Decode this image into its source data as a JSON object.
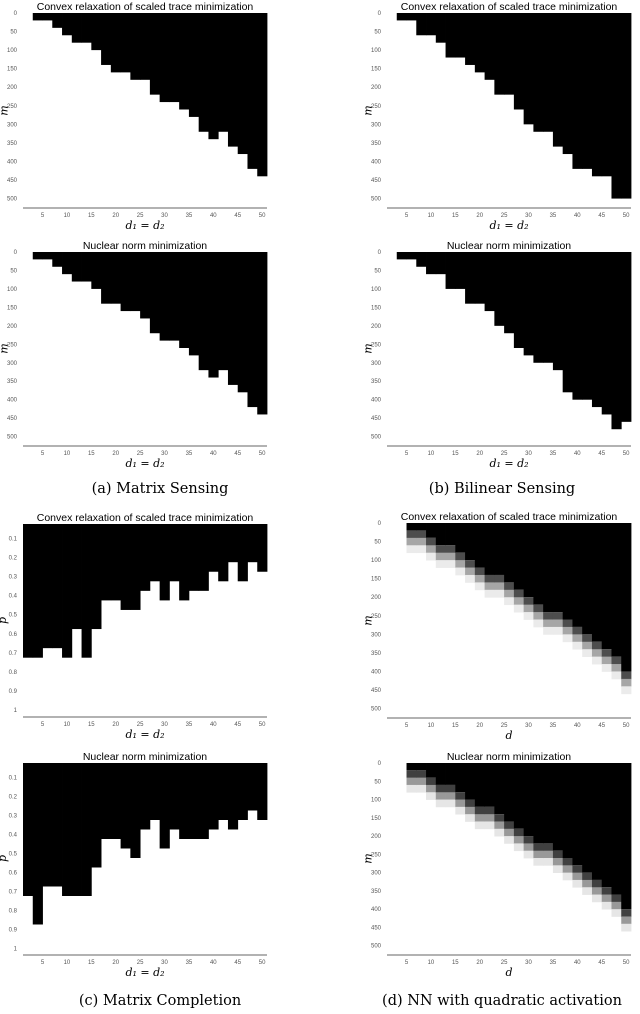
{
  "captions": {
    "a": "(a) Matrix Sensing",
    "b": "(b) Bilinear Sensing",
    "c": "(c) Matrix Completion",
    "d": "(d) NN with quadratic activation"
  },
  "colors": {
    "failure": "#000000",
    "success": "#ffffff",
    "axis": "#999999"
  },
  "chart_data": [
    {
      "id": "a1",
      "type": "heatmap",
      "title": "Convex relaxation of scaled trace minimization",
      "xlabel": "d₁ = d₂",
      "ylabel": "m",
      "x_columns": [
        2,
        4,
        6,
        8,
        10,
        12,
        14,
        16,
        18,
        20,
        22,
        24,
        26,
        28,
        30,
        32,
        34,
        36,
        38,
        40,
        42,
        44,
        46,
        48,
        50
      ],
      "xticks": [
        5,
        10,
        15,
        20,
        25,
        30,
        35,
        40,
        45,
        50
      ],
      "yticks": [
        0,
        50,
        100,
        150,
        200,
        250,
        300,
        350,
        400,
        450,
        500
      ],
      "ylim": [
        0,
        520
      ],
      "failure_boundary": [
        0,
        20,
        20,
        40,
        60,
        80,
        80,
        100,
        140,
        160,
        160,
        180,
        180,
        220,
        240,
        240,
        260,
        280,
        320,
        340,
        320,
        360,
        380,
        420,
        440
      ]
    },
    {
      "id": "a2",
      "type": "heatmap",
      "title": "Nuclear norm minimization",
      "xlabel": "d₁ = d₂",
      "ylabel": "m",
      "x_columns": [
        2,
        4,
        6,
        8,
        10,
        12,
        14,
        16,
        18,
        20,
        22,
        24,
        26,
        28,
        30,
        32,
        34,
        36,
        38,
        40,
        42,
        44,
        46,
        48,
        50
      ],
      "xticks": [
        5,
        10,
        15,
        20,
        25,
        30,
        35,
        40,
        45,
        50
      ],
      "yticks": [
        0,
        50,
        100,
        150,
        200,
        250,
        300,
        350,
        400,
        450,
        500
      ],
      "ylim": [
        0,
        520
      ],
      "failure_boundary": [
        0,
        20,
        20,
        40,
        60,
        80,
        80,
        100,
        140,
        140,
        160,
        160,
        180,
        220,
        240,
        240,
        260,
        280,
        320,
        340,
        320,
        360,
        380,
        420,
        440
      ]
    },
    {
      "id": "b1",
      "type": "heatmap",
      "title": "Convex relaxation of scaled trace minimization",
      "xlabel": "d₁ = d₂",
      "ylabel": "m",
      "x_columns": [
        2,
        4,
        6,
        8,
        10,
        12,
        14,
        16,
        18,
        20,
        22,
        24,
        26,
        28,
        30,
        32,
        34,
        36,
        38,
        40,
        42,
        44,
        46,
        48,
        50
      ],
      "xticks": [
        5,
        10,
        15,
        20,
        25,
        30,
        35,
        40,
        45,
        50
      ],
      "yticks": [
        0,
        50,
        100,
        150,
        200,
        250,
        300,
        350,
        400,
        450,
        500
      ],
      "ylim": [
        0,
        520
      ],
      "failure_boundary": [
        0,
        20,
        20,
        60,
        60,
        80,
        120,
        120,
        140,
        160,
        180,
        220,
        220,
        260,
        300,
        320,
        320,
        360,
        380,
        420,
        420,
        440,
        440,
        500,
        500
      ]
    },
    {
      "id": "b2",
      "type": "heatmap",
      "title": "Nuclear norm minimization",
      "xlabel": "d₁ = d₂",
      "ylabel": "m",
      "x_columns": [
        2,
        4,
        6,
        8,
        10,
        12,
        14,
        16,
        18,
        20,
        22,
        24,
        26,
        28,
        30,
        32,
        34,
        36,
        38,
        40,
        42,
        44,
        46,
        48,
        50
      ],
      "xticks": [
        5,
        10,
        15,
        20,
        25,
        30,
        35,
        40,
        45,
        50
      ],
      "yticks": [
        0,
        50,
        100,
        150,
        200,
        250,
        300,
        350,
        400,
        450,
        500
      ],
      "ylim": [
        0,
        520
      ],
      "failure_boundary": [
        0,
        20,
        20,
        40,
        60,
        60,
        100,
        100,
        140,
        140,
        160,
        200,
        220,
        260,
        280,
        300,
        300,
        320,
        380,
        400,
        400,
        420,
        440,
        480,
        460
      ]
    },
    {
      "id": "c1",
      "type": "heatmap",
      "title": "Convex relaxation of scaled trace minimization",
      "xlabel": "d₁ = d₂",
      "ylabel": "p",
      "x_columns": [
        2,
        4,
        6,
        8,
        10,
        12,
        14,
        16,
        18,
        20,
        22,
        24,
        26,
        28,
        30,
        32,
        34,
        36,
        38,
        40,
        42,
        44,
        46,
        48,
        50
      ],
      "xticks": [
        5,
        10,
        15,
        20,
        25,
        30,
        35,
        40,
        45,
        50
      ],
      "yticks": [
        0.1,
        0.2,
        0.3,
        0.4,
        0.5,
        0.6,
        0.7,
        0.8,
        0.9,
        1
      ],
      "ylim": [
        0.025,
        1.025
      ],
      "failure_boundary": [
        0.725,
        0.725,
        0.675,
        0.675,
        0.725,
        0.575,
        0.725,
        0.575,
        0.425,
        0.425,
        0.475,
        0.475,
        0.375,
        0.325,
        0.425,
        0.325,
        0.425,
        0.375,
        0.375,
        0.275,
        0.325,
        0.225,
        0.325,
        0.225,
        0.275
      ]
    },
    {
      "id": "c2",
      "type": "heatmap",
      "title": "Nuclear norm minimization",
      "xlabel": "d₁ = d₂",
      "ylabel": "p",
      "x_columns": [
        2,
        4,
        6,
        8,
        10,
        12,
        14,
        16,
        18,
        20,
        22,
        24,
        26,
        28,
        30,
        32,
        34,
        36,
        38,
        40,
        42,
        44,
        46,
        48,
        50
      ],
      "xticks": [
        5,
        10,
        15,
        20,
        25,
        30,
        35,
        40,
        45,
        50
      ],
      "yticks": [
        0.1,
        0.2,
        0.3,
        0.4,
        0.5,
        0.6,
        0.7,
        0.8,
        0.9,
        1
      ],
      "ylim": [
        0.025,
        1.025
      ],
      "failure_boundary": [
        0.725,
        0.875,
        0.675,
        0.675,
        0.725,
        0.725,
        0.725,
        0.575,
        0.425,
        0.425,
        0.475,
        0.525,
        0.375,
        0.325,
        0.475,
        0.375,
        0.425,
        0.425,
        0.425,
        0.375,
        0.325,
        0.375,
        0.325,
        0.275,
        0.325
      ]
    },
    {
      "id": "d1",
      "type": "heatmap",
      "title": "Convex relaxation of scaled trace minimization",
      "xlabel": "d",
      "ylabel": "m",
      "x_columns": [
        2,
        4,
        6,
        8,
        10,
        12,
        14,
        16,
        18,
        20,
        22,
        24,
        26,
        28,
        30,
        32,
        34,
        36,
        38,
        40,
        42,
        44,
        46,
        48,
        50
      ],
      "xticks": [
        5,
        10,
        15,
        20,
        25,
        30,
        35,
        40,
        45,
        50
      ],
      "yticks": [
        0,
        50,
        100,
        150,
        200,
        250,
        300,
        350,
        400,
        450,
        500
      ],
      "ylim": [
        0,
        520
      ],
      "failure_boundary": [
        0,
        0,
        20,
        20,
        40,
        60,
        60,
        80,
        100,
        120,
        140,
        140,
        160,
        180,
        200,
        220,
        240,
        240,
        260,
        280,
        300,
        320,
        340,
        360,
        400
      ],
      "transition_failure_rate": [
        0.7,
        0.35,
        0.08
      ]
    },
    {
      "id": "d2",
      "type": "heatmap",
      "title": "Nuclear norm minimization",
      "xlabel": "d",
      "ylabel": "m",
      "x_columns": [
        2,
        4,
        6,
        8,
        10,
        12,
        14,
        16,
        18,
        20,
        22,
        24,
        26,
        28,
        30,
        32,
        34,
        36,
        38,
        40,
        42,
        44,
        46,
        48,
        50
      ],
      "xticks": [
        5,
        10,
        15,
        20,
        25,
        30,
        35,
        40,
        45,
        50
      ],
      "yticks": [
        0,
        50,
        100,
        150,
        200,
        250,
        300,
        350,
        400,
        450,
        500
      ],
      "ylim": [
        0,
        520
      ],
      "failure_boundary": [
        0,
        0,
        20,
        20,
        40,
        60,
        60,
        80,
        100,
        120,
        120,
        140,
        160,
        180,
        200,
        220,
        220,
        240,
        260,
        280,
        300,
        320,
        340,
        360,
        400
      ],
      "transition_failure_rate": [
        0.75,
        0.4,
        0.1
      ]
    }
  ]
}
